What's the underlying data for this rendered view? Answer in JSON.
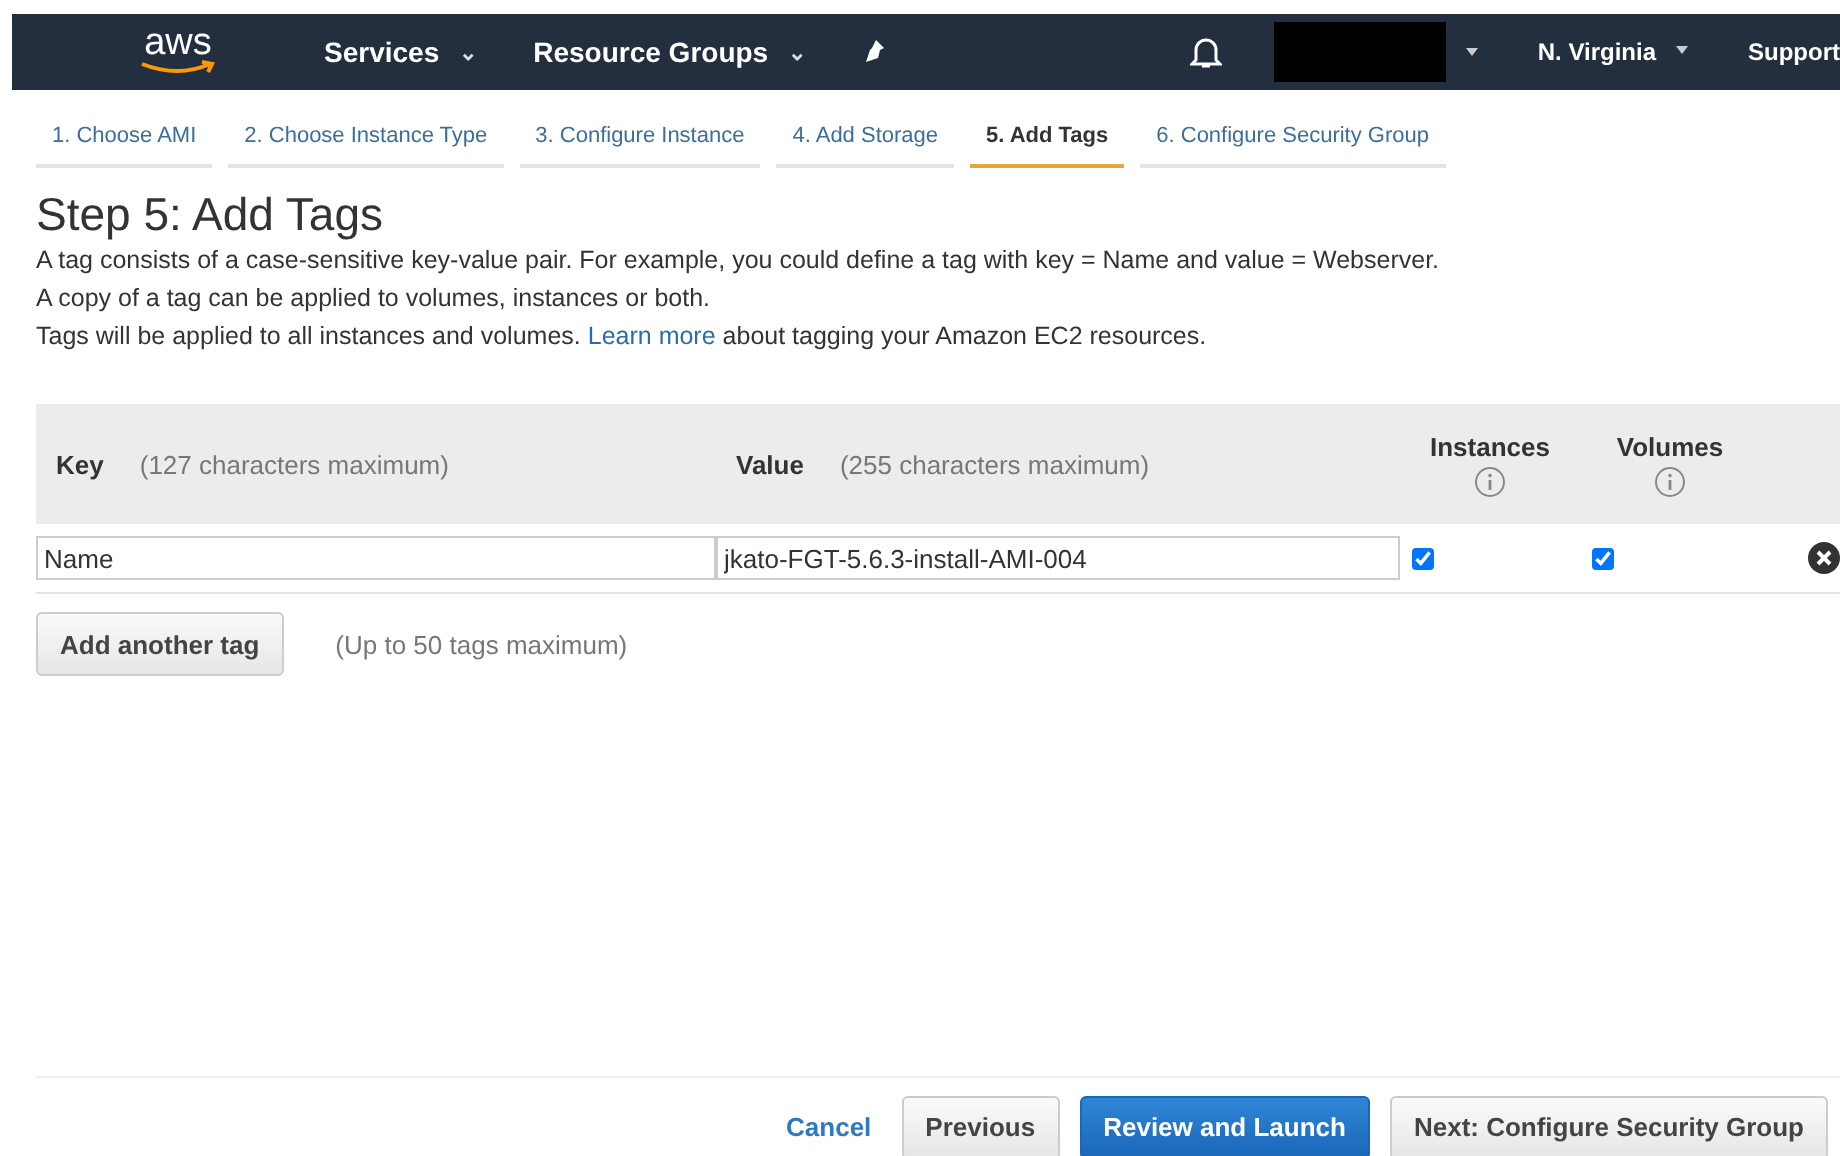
{
  "nav": {
    "logo": "aws",
    "menus": [
      {
        "label": "Services",
        "caret": "⌄"
      },
      {
        "label": "Resource Groups",
        "caret": "⌄"
      }
    ],
    "region": "N. Virginia",
    "support": "Support"
  },
  "steps": [
    {
      "label": "1. Choose AMI",
      "selected": false
    },
    {
      "label": "2. Choose Instance Type",
      "selected": false
    },
    {
      "label": "3. Configure Instance",
      "selected": false
    },
    {
      "label": "4. Add Storage",
      "selected": false
    },
    {
      "label": "5. Add Tags",
      "selected": true
    },
    {
      "label": "6. Configure Security Group",
      "selected": false
    }
  ],
  "title": "Step 5: Add Tags",
  "intro": [
    "A tag consists of a case-sensitive key-value pair. For example, you could define a tag with key = Name and value = Webserver.",
    "A copy of a tag can be applied to volumes, instances or both."
  ],
  "intro_link": {
    "before": "Tags will be applied to all instances and volumes.",
    "link": "Learn more",
    "after": "about tagging your Amazon EC2 resources."
  },
  "table": {
    "key_header": "Key",
    "key_hint": "(127 characters maximum)",
    "value_header": "Value",
    "value_hint": "(255 characters maximum)",
    "instances_header": "Instances",
    "volumes_header": "Volumes",
    "rows": [
      {
        "key": "Name",
        "value": "jkato-FGT-5.6.3-install-AMI-004",
        "instances": true,
        "volumes": true
      }
    ]
  },
  "add_button": "Add another tag",
  "add_hint": "(Up to 50 tags maximum)",
  "footer": {
    "cancel": "Cancel",
    "previous": "Previous",
    "review": "Review and Launch",
    "next": "Next: Configure Security Group"
  }
}
